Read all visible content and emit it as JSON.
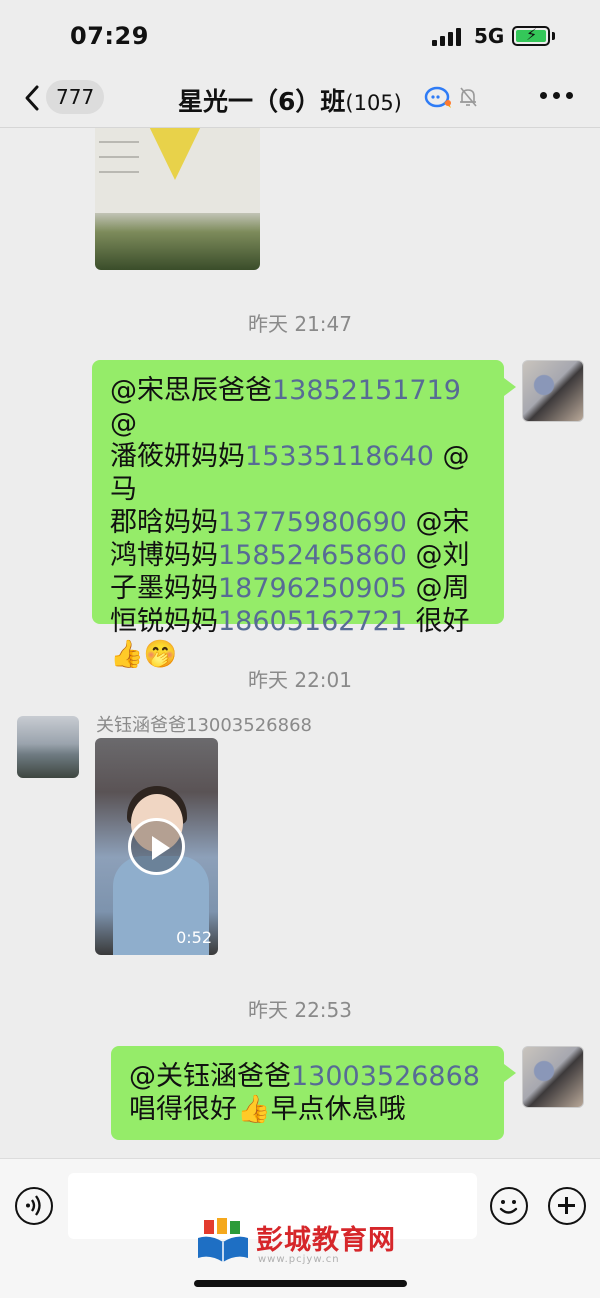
{
  "status_bar": {
    "time": "07:29",
    "network": "5G"
  },
  "nav": {
    "back_unread": "777",
    "title": "星光一（6）班",
    "member_count": "(105)"
  },
  "messages": [
    {
      "timestamp": "昨天 21:47"
    },
    {
      "outgoing_1": {
        "segments": [
          {
            "t": "@宋思辰爸爸",
            "phone": false
          },
          {
            "t": "13852151719",
            "phone": true
          },
          {
            "t": " @",
            "phone": false
          },
          {
            "t": "潘筱妍妈妈",
            "phone": false
          },
          {
            "t": "15335118640",
            "phone": true
          },
          {
            "t": " @马",
            "phone": false
          },
          {
            "t": "郡晗妈妈",
            "phone": false
          },
          {
            "t": "13775980690",
            "phone": true
          },
          {
            "t": " @宋",
            "phone": false
          },
          {
            "t": "鸿博妈妈",
            "phone": false
          },
          {
            "t": "15852465860",
            "phone": true
          },
          {
            "t": " @刘",
            "phone": false
          },
          {
            "t": "子墨妈妈",
            "phone": false
          },
          {
            "t": "18796250905",
            "phone": true
          },
          {
            "t": " @周",
            "phone": false
          },
          {
            "t": "恒锐妈妈",
            "phone": false
          },
          {
            "t": "18605162721",
            "phone": true
          },
          {
            "t": " 很好",
            "phone": false
          },
          {
            "t": "👍🤭",
            "phone": false
          }
        ]
      }
    }
  ],
  "timestamp_1": "昨天 21:47",
  "timestamp_2": "昨天 22:01",
  "timestamp_3": "昨天 22:53",
  "bubble_1": {
    "line1_a": "@宋思辰爸爸",
    "line1_b": "13852151719",
    "line1_c": " @",
    "line2_a": "潘筱妍妈妈",
    "line2_b": "15335118640",
    "line2_c": " @马",
    "line3_a": "郡晗妈妈",
    "line3_b": "13775980690",
    "line3_c": " @宋",
    "line4_a": "鸿博妈妈",
    "line4_b": "15852465860",
    "line4_c": " @刘",
    "line5_a": "子墨妈妈",
    "line5_b": "18796250905",
    "line5_c": " @周",
    "line6_a": "恒锐妈妈",
    "line6_b": "18605162721",
    "line6_c": " 很好",
    "line7": "👍🤭"
  },
  "video_message": {
    "sender": "关钰涵爸爸13003526868",
    "duration": "0:52"
  },
  "bubble_2": {
    "line1_a": "@关钰涵爸爸",
    "line1_b": "13003526868",
    "line2": "唱得很好👍早点休息哦"
  },
  "watermark": {
    "text": "彭城教育网",
    "url": "www.pcjyw.cn"
  },
  "colors": {
    "bubble_out": "#95ec69",
    "phone_link": "#576b95",
    "background": "#ededed",
    "battery": "#34c759"
  }
}
